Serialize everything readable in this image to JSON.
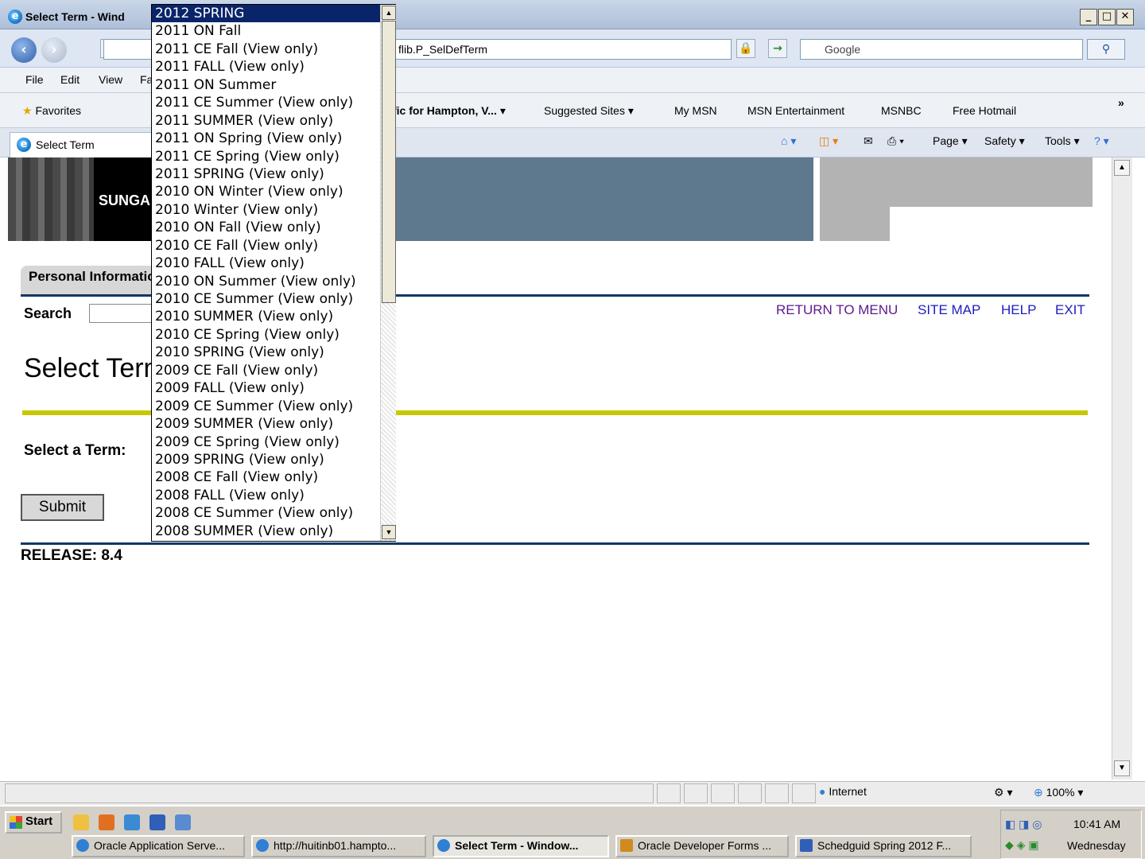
{
  "window": {
    "title": "Select Term - Windows Internet Explorer",
    "visible_title": "Select Term - Wind"
  },
  "address": {
    "url_fragment": "flib.P_SelDefTerm",
    "search_placeholder": "Google"
  },
  "menu": {
    "items": [
      "File",
      "Edit",
      "View",
      "Fa"
    ]
  },
  "favorites": {
    "label": "Favorites",
    "items": [
      "fic for Hampton, V...",
      "Suggested Sites",
      "My MSN",
      "MSN Entertainment",
      "MSNBC",
      "Free Hotmail"
    ]
  },
  "tab": {
    "label": "Select Term"
  },
  "commands": {
    "page": "Page",
    "safety": "Safety",
    "tools": "Tools"
  },
  "page": {
    "banner_text": "SUNGA",
    "tab_label": "Personal Information",
    "search_label": "Search",
    "links": [
      "RETURN TO MENU",
      "SITE MAP",
      "HELP",
      "EXIT"
    ],
    "title": "Select Term",
    "select_label": "Select a Term:",
    "submit": "Submit",
    "release": "RELEASE: 8.4"
  },
  "dropdown": {
    "selected": "2012 SPRING",
    "options": [
      "2012 SPRING",
      "2011 ON Fall",
      "2011 CE Fall (View only)",
      "2011 FALL (View only)",
      "2011 ON Summer",
      "2011 CE Summer (View only)",
      "2011 SUMMER (View only)",
      "2011 ON Spring (View only)",
      "2011 CE Spring (View only)",
      "2011 SPRING (View only)",
      "2010 ON Winter (View only)",
      "2010 Winter (View only)",
      "2010 ON Fall (View only)",
      "2010 CE Fall (View only)",
      "2010 FALL (View only)",
      "2010 ON Summer (View only)",
      "2010 CE Summer (View only)",
      "2010 SUMMER (View only)",
      "2010 CE Spring (View only)",
      "2010 SPRING (View only)",
      "2009 CE Fall (View only)",
      "2009 FALL (View only)",
      "2009 CE Summer (View only)",
      "2009 SUMMER (View only)",
      "2009 CE Spring (View only)",
      "2009 SPRING (View only)",
      "2008 CE Fall (View only)",
      "2008 FALL (View only)",
      "2008 CE Summer (View only)",
      "2008 SUMMER (View only)"
    ]
  },
  "status": {
    "zone": "Internet",
    "zoom": "100%"
  },
  "taskbar": {
    "start": "Start",
    "tasks": [
      "Oracle Application Serve...",
      "http://huitinb01.hampto...",
      "Select Term - Window...",
      "Oracle Developer Forms ...",
      "Schedguid Spring 2012 F..."
    ],
    "clock": "10:41 AM",
    "day": "Wednesday"
  },
  "colors": {
    "selection": "#0a246a",
    "banner_blue": "#5e788e",
    "rule_navy": "#0c3866",
    "rule_yellow": "#c8c800",
    "link": "#1d1dbd"
  },
  "icons": [
    "ie-icon",
    "back-icon",
    "forward-icon",
    "refresh-icon",
    "stop-icon",
    "lock-icon",
    "go-icon",
    "search-icon",
    "star-icon",
    "home-icon",
    "feeds-icon",
    "mail-icon",
    "print-icon",
    "help-icon",
    "globe-icon"
  ]
}
